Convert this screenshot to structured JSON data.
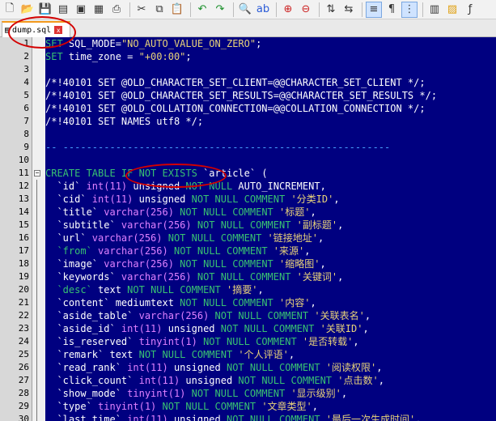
{
  "toolbar": {
    "icons": [
      "new-file",
      "open-file",
      "save-file",
      "save-all",
      "close-file",
      "close-all",
      "print",
      "cut",
      "copy",
      "paste",
      "undo",
      "redo",
      "find",
      "replace",
      "zoom-in",
      "zoom-out",
      "sync-vertical",
      "sync-horizontal",
      "word-wrap",
      "show-all-chars",
      "indent-guide",
      "user-language",
      "doc-map",
      "function-list"
    ]
  },
  "tab": {
    "filename": "dump.sql",
    "close": "x"
  },
  "lines": [
    {
      "num": "1",
      "tokens": [
        [
          "kw",
          "SET"
        ],
        [
          "plain",
          " SQL_MODE="
        ],
        [
          "str",
          "\"NO_AUTO_VALUE_ON_ZERO\""
        ],
        [
          "plain",
          ";"
        ]
      ]
    },
    {
      "num": "2",
      "tokens": [
        [
          "kw",
          "SET"
        ],
        [
          "plain",
          " time_zone = "
        ],
        [
          "str",
          "\"+00:00\""
        ],
        [
          "plain",
          ";"
        ]
      ]
    },
    {
      "num": "3",
      "tokens": []
    },
    {
      "num": "4",
      "tokens": [
        [
          "plain",
          "/*!40101 SET @OLD_CHARACTER_SET_CLIENT=@@CHARACTER_SET_CLIENT */;"
        ]
      ]
    },
    {
      "num": "5",
      "tokens": [
        [
          "plain",
          "/*!40101 SET @OLD_CHARACTER_SET_RESULTS=@@CHARACTER_SET_RESULTS */;"
        ]
      ]
    },
    {
      "num": "6",
      "tokens": [
        [
          "plain",
          "/*!40101 SET @OLD_COLLATION_CONNECTION=@@COLLATION_CONNECTION */;"
        ]
      ]
    },
    {
      "num": "7",
      "tokens": [
        [
          "plain",
          "/*!40101 SET NAMES utf8 */;"
        ]
      ]
    },
    {
      "num": "8",
      "tokens": []
    },
    {
      "num": "9",
      "tokens": [
        [
          "dash",
          "-- --------------------------------------------------------"
        ]
      ]
    },
    {
      "num": "10",
      "tokens": []
    },
    {
      "num": "11",
      "tokens": [
        [
          "kw",
          "CREATE TABLE IF NOT EXISTS"
        ],
        [
          "plain",
          " `article` ("
        ]
      ]
    },
    {
      "num": "12",
      "tokens": [
        [
          "plain",
          "  `id` "
        ],
        [
          "type",
          "int(11)"
        ],
        [
          "plain",
          " unsigned "
        ],
        [
          "kw",
          "NOT NULL"
        ],
        [
          "plain",
          " AUTO_INCREMENT,"
        ]
      ]
    },
    {
      "num": "13",
      "tokens": [
        [
          "plain",
          "  `cid` "
        ],
        [
          "type",
          "int(11)"
        ],
        [
          "plain",
          " unsigned "
        ],
        [
          "kw",
          "NOT NULL COMMENT"
        ],
        [
          "str",
          " '分类ID'"
        ],
        [
          "plain",
          ","
        ]
      ]
    },
    {
      "num": "14",
      "tokens": [
        [
          "plain",
          "  `title` "
        ],
        [
          "type",
          "varchar(256)"
        ],
        [
          "kw",
          " NOT NULL COMMENT"
        ],
        [
          "str",
          " '标题'"
        ],
        [
          "plain",
          ","
        ]
      ]
    },
    {
      "num": "15",
      "tokens": [
        [
          "plain",
          "  `subtitle` "
        ],
        [
          "type",
          "varchar(256)"
        ],
        [
          "kw",
          " NOT NULL COMMENT"
        ],
        [
          "str",
          " '副标题'"
        ],
        [
          "plain",
          ","
        ]
      ]
    },
    {
      "num": "16",
      "tokens": [
        [
          "plain",
          "  `url` "
        ],
        [
          "type",
          "varchar(256)"
        ],
        [
          "kw",
          " NOT NULL COMMENT"
        ],
        [
          "str",
          " '链接地址'"
        ],
        [
          "plain",
          ","
        ]
      ]
    },
    {
      "num": "17",
      "tokens": [
        [
          "plain",
          "  "
        ],
        [
          "kw",
          "`from`"
        ],
        [
          "plain",
          " "
        ],
        [
          "type",
          "varchar(256)"
        ],
        [
          "kw",
          " NOT NULL COMMENT"
        ],
        [
          "str",
          " '来源'"
        ],
        [
          "plain",
          ","
        ]
      ]
    },
    {
      "num": "18",
      "tokens": [
        [
          "plain",
          "  `image` "
        ],
        [
          "type",
          "varchar(256)"
        ],
        [
          "kw",
          " NOT NULL COMMENT"
        ],
        [
          "str",
          " '缩略图'"
        ],
        [
          "plain",
          ","
        ]
      ]
    },
    {
      "num": "19",
      "tokens": [
        [
          "plain",
          "  `keywords` "
        ],
        [
          "type",
          "varchar(256)"
        ],
        [
          "kw",
          " NOT NULL COMMENT"
        ],
        [
          "str",
          " '关键词'"
        ],
        [
          "plain",
          ","
        ]
      ]
    },
    {
      "num": "20",
      "tokens": [
        [
          "plain",
          "  "
        ],
        [
          "kw",
          "`desc`"
        ],
        [
          "plain",
          " text "
        ],
        [
          "kw",
          "NOT NULL COMMENT"
        ],
        [
          "str",
          " '摘要'"
        ],
        [
          "plain",
          ","
        ]
      ]
    },
    {
      "num": "21",
      "tokens": [
        [
          "plain",
          "  `content` mediumtext "
        ],
        [
          "kw",
          "NOT NULL COMMENT"
        ],
        [
          "str",
          " '内容'"
        ],
        [
          "plain",
          ","
        ]
      ]
    },
    {
      "num": "22",
      "tokens": [
        [
          "plain",
          "  `aside_table` "
        ],
        [
          "type",
          "varchar(256)"
        ],
        [
          "kw",
          " NOT NULL COMMENT"
        ],
        [
          "str",
          " '关联表名'"
        ],
        [
          "plain",
          ","
        ]
      ]
    },
    {
      "num": "23",
      "tokens": [
        [
          "plain",
          "  `aside_id` "
        ],
        [
          "type",
          "int(11)"
        ],
        [
          "plain",
          " unsigned "
        ],
        [
          "kw",
          "NOT NULL COMMENT"
        ],
        [
          "str",
          " '关联ID'"
        ],
        [
          "plain",
          ","
        ]
      ]
    },
    {
      "num": "24",
      "tokens": [
        [
          "plain",
          "  `is_reserved` "
        ],
        [
          "type",
          "tinyint(1)"
        ],
        [
          "kw",
          " NOT NULL COMMENT"
        ],
        [
          "str",
          " '是否转载'"
        ],
        [
          "plain",
          ","
        ]
      ]
    },
    {
      "num": "25",
      "tokens": [
        [
          "plain",
          "  `remark` text "
        ],
        [
          "kw",
          "NOT NULL COMMENT"
        ],
        [
          "str",
          " '个人评语'"
        ],
        [
          "plain",
          ","
        ]
      ]
    },
    {
      "num": "26",
      "tokens": [
        [
          "plain",
          "  `read_rank` "
        ],
        [
          "type",
          "int(11)"
        ],
        [
          "plain",
          " unsigned "
        ],
        [
          "kw",
          "NOT NULL COMMENT"
        ],
        [
          "str",
          " '阅读权限'"
        ],
        [
          "plain",
          ","
        ]
      ]
    },
    {
      "num": "27",
      "tokens": [
        [
          "plain",
          "  `click_count` "
        ],
        [
          "type",
          "int(11)"
        ],
        [
          "plain",
          " unsigned "
        ],
        [
          "kw",
          "NOT NULL COMMENT"
        ],
        [
          "str",
          " '点击数'"
        ],
        [
          "plain",
          ","
        ]
      ]
    },
    {
      "num": "28",
      "tokens": [
        [
          "plain",
          "  `show_mode` "
        ],
        [
          "type",
          "tinyint(1)"
        ],
        [
          "kw",
          " NOT NULL COMMENT"
        ],
        [
          "str",
          " '显示级别'"
        ],
        [
          "plain",
          ","
        ]
      ]
    },
    {
      "num": "29",
      "tokens": [
        [
          "plain",
          "  `type` "
        ],
        [
          "type",
          "tinyint(1)"
        ],
        [
          "kw",
          " NOT NULL COMMENT"
        ],
        [
          "str",
          " '文章类型'"
        ],
        [
          "plain",
          ","
        ]
      ]
    },
    {
      "num": "30",
      "tokens": [
        [
          "plain",
          "  `last_time` "
        ],
        [
          "type",
          "int(11)"
        ],
        [
          "plain",
          " unsigned "
        ],
        [
          "kw",
          "NOT NULL COMMENT"
        ],
        [
          "str",
          " '最后一次生成时间'"
        ],
        [
          "plain",
          ","
        ]
      ]
    }
  ],
  "colors": {
    "editor_bg": "#000080",
    "keyword": "#38c172",
    "string": "#e8d27a",
    "annotation": "#d40000"
  }
}
